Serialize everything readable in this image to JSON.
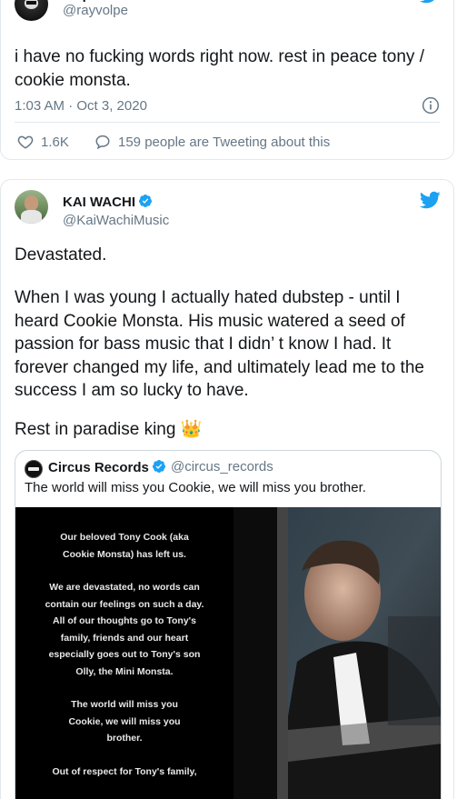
{
  "tweet1": {
    "display_name": "volpetron",
    "handle": "@rayvolpe",
    "text": "i have no fucking words right now. rest in peace tony / cookie monsta.",
    "timestamp": "1:03 AM · Oct 3, 2020",
    "likes": "1.6K",
    "tweeting_about": "159 people are Tweeting about this"
  },
  "tweet2": {
    "display_name": "KAI WACHI",
    "handle": "@KaiWachiMusic",
    "text_line1": "Devastated.",
    "text_paragraph": "When I was young I actually hated dubstep - until I heard Cookie Monsta. His music watered a seed of passion for bass music that I didn’ t know I had. It forever changed my life, and ultimately lead me to the success I am so lucky to have.",
    "text_closing": "Rest in paradise king 👑"
  },
  "quote": {
    "display_name": "Circus Records",
    "handle": "@circus_records",
    "text": "The world will miss you Cookie, we will miss you brother.",
    "statement_paragraphs": [
      "Our beloved Tony Cook (aka Cookie Monsta) has left us.",
      "We are devastated, no words can contain our feelings on such a day. All of our thoughts go to Tony's family, friends and our heart especially goes out to Tony's son Olly, the Mini Monsta.",
      "The world will miss you Cookie, we will miss you brother.",
      "Out of respect for Tony's family,"
    ]
  },
  "colors": {
    "twitter_blue": "#1da1f2",
    "text_primary": "#14171a",
    "text_secondary": "#657786",
    "border": "#e1e8ed"
  }
}
